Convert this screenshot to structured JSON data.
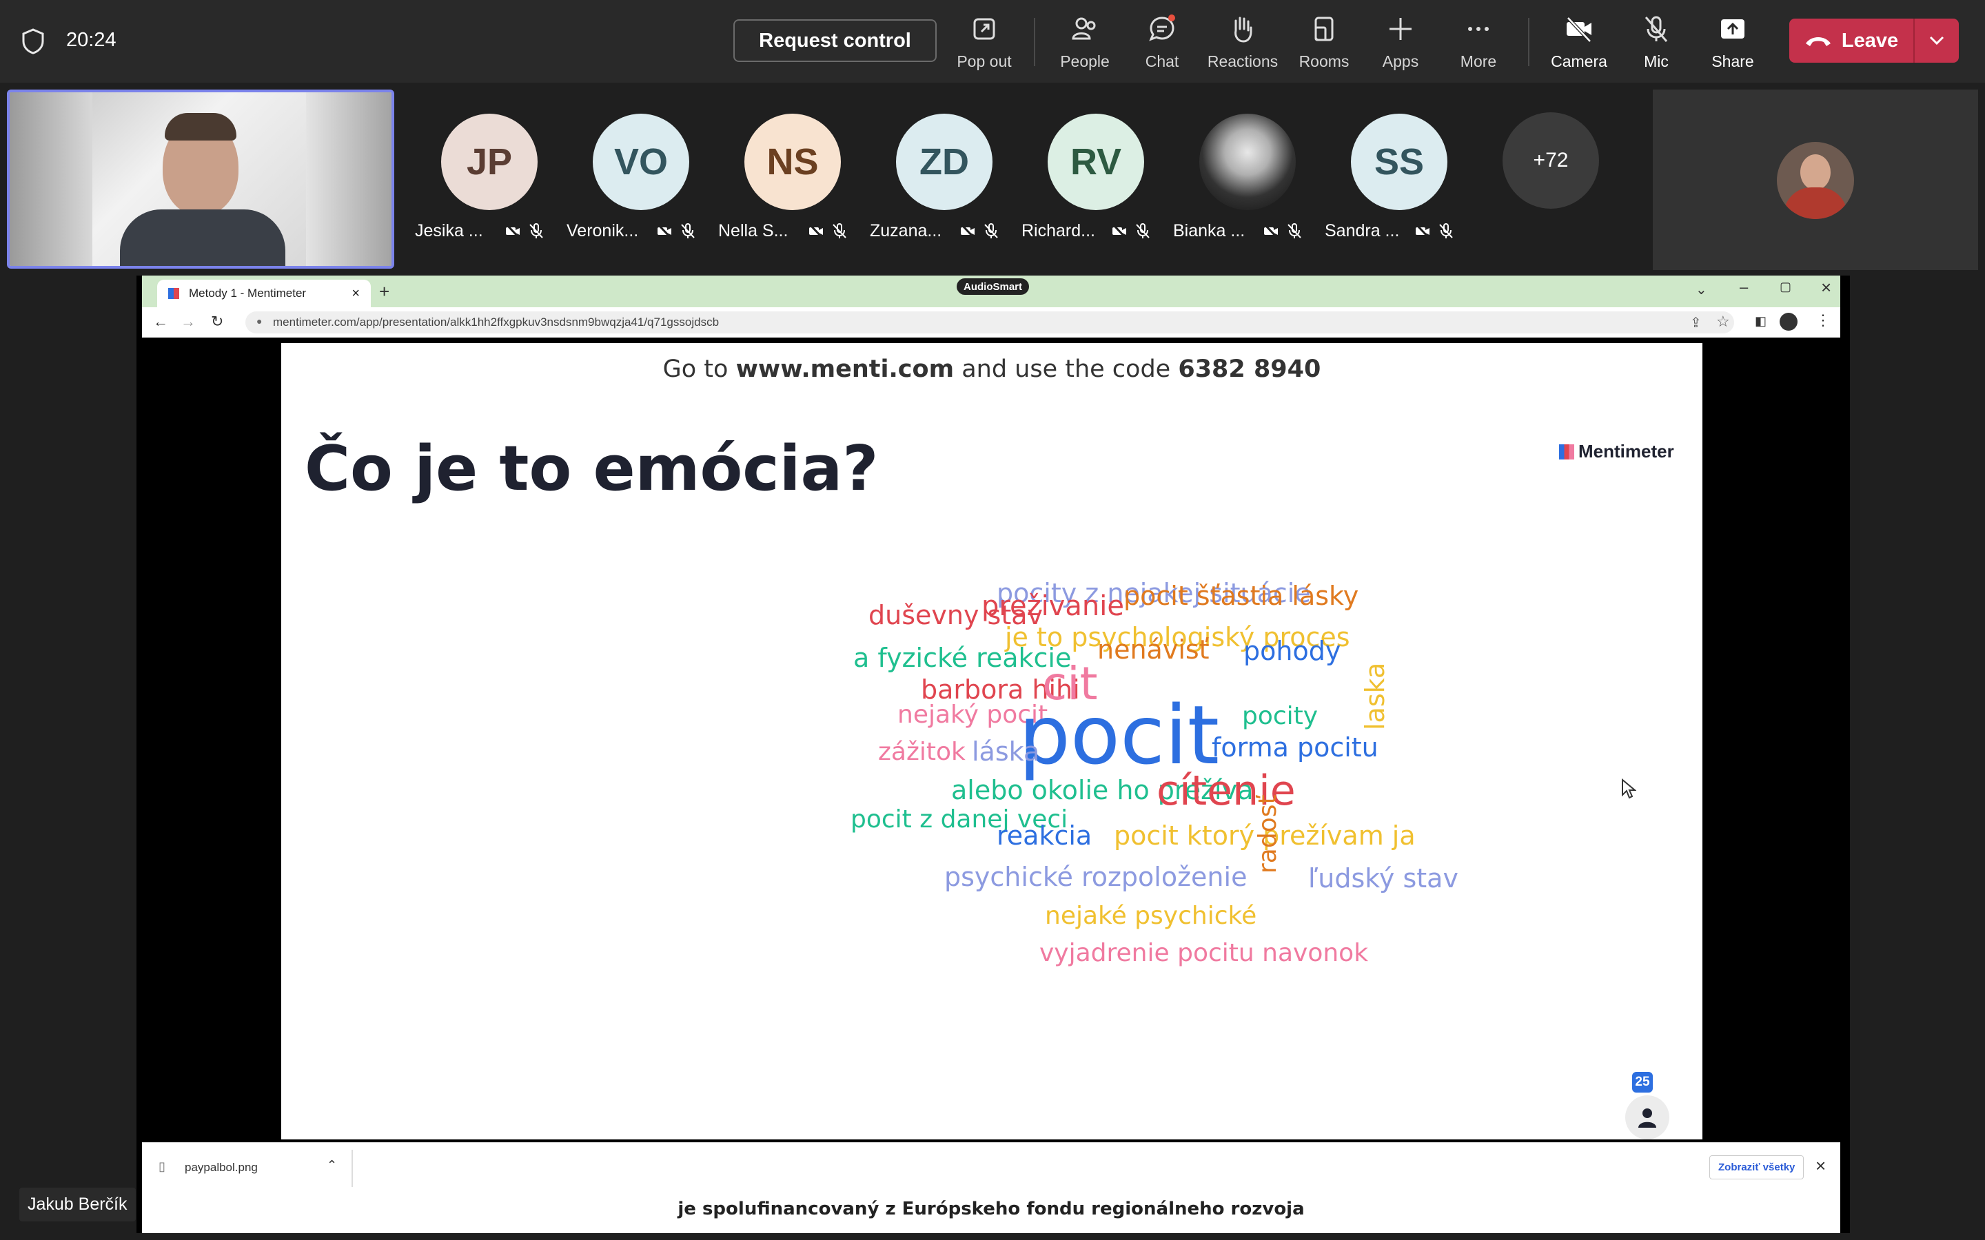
{
  "topbar": {
    "time": "20:24",
    "request_control": "Request control",
    "buttons": {
      "popout": "Pop out",
      "people": "People",
      "chat": "Chat",
      "reactions": "Reactions",
      "rooms": "Rooms",
      "apps": "Apps",
      "more": "More",
      "camera": "Camera",
      "mic": "Mic",
      "share": "Share"
    },
    "leave": "Leave"
  },
  "participants": [
    {
      "initials": "JP",
      "name": "Jesika ...",
      "bg": "#ebdcd6",
      "fg": "#5a3d33"
    },
    {
      "initials": "VO",
      "name": "Veronik...",
      "bg": "#dcecf0",
      "fg": "#33555e"
    },
    {
      "initials": "NS",
      "name": "Nella S...",
      "bg": "#f8e3d0",
      "fg": "#6b4021"
    },
    {
      "initials": "ZD",
      "name": "Zuzana...",
      "bg": "#dcecf0",
      "fg": "#33555e"
    },
    {
      "initials": "RV",
      "name": "Richard...",
      "bg": "#dcefe4",
      "fg": "#2d5a41"
    },
    {
      "initials": "",
      "name": "Bianka ...",
      "bg": "#222222",
      "fg": "#ffffff"
    },
    {
      "initials": "SS",
      "name": "Sandra ...",
      "bg": "#dcecf0",
      "fg": "#33555e"
    }
  ],
  "overflow_count": "+72",
  "presenter_name": "Jakub Berčík",
  "browser": {
    "brand_badge": "AudioSmart",
    "tab_title": "Metody 1 - Mentimeter",
    "url": "mentimeter.com/app/presentation/alkk1hh2ffxgpkuv3nsdsnm9bwqzja41/q71gssojdscb",
    "download_file": "paypalbol.png",
    "show_all": "Zobraziť všetky",
    "bottom_text": "je spolufinancovaný z Európskeho fondu regionálneho rozvoja"
  },
  "slide": {
    "join_prefix": "Go to ",
    "join_site": "www.menti.com",
    "join_mid": " and use the code ",
    "join_code": "6382 8940",
    "question": "Čo je to emócia?",
    "logo": "Mentimeter",
    "responses": "25",
    "words": [
      {
        "text": "pocity z nejakej situácie",
        "color": "#8c9ae0"
      },
      {
        "text": "duševny stav",
        "color": "#e0454f"
      },
      {
        "text": "preživanie",
        "color": "#e0454f"
      },
      {
        "text": "pocit šťastia lásky",
        "color": "#e07a1f"
      },
      {
        "text": "je to psychologiský proces",
        "color": "#f0c030"
      },
      {
        "text": "a fyzické reakcie",
        "color": "#1fbf8f"
      },
      {
        "text": "barbora hihi",
        "color": "#e0454f"
      },
      {
        "text": "cit",
        "color": "#f07aa0"
      },
      {
        "text": "nenávisť",
        "color": "#e07a1f"
      },
      {
        "text": "pohody",
        "color": "#2d6fe0"
      },
      {
        "text": "nejaký pocit",
        "color": "#f07aa0"
      },
      {
        "text": "pocit",
        "color": "#2d6fe0"
      },
      {
        "text": "pocity",
        "color": "#1fbf8f"
      },
      {
        "text": "laska",
        "color": "#f0c030"
      },
      {
        "text": "zážitok",
        "color": "#f07aa0"
      },
      {
        "text": "láska",
        "color": "#8c9ae0"
      },
      {
        "text": "forma pocitu",
        "color": "#2d6fe0"
      },
      {
        "text": "alebo okolie ho prežíva",
        "color": "#1fbf8f"
      },
      {
        "text": "cítenie",
        "color": "#e0454f"
      },
      {
        "text": "pocit z danej veci",
        "color": "#1fbf8f"
      },
      {
        "text": "reakcia",
        "color": "#2d6fe0"
      },
      {
        "text": "pocit ktorý prežívam ja",
        "color": "#f0c030"
      },
      {
        "text": "psychické rozpoloženie",
        "color": "#8c9ae0"
      },
      {
        "text": "radosť",
        "color": "#e07a1f"
      },
      {
        "text": "ľudský stav",
        "color": "#8c9ae0"
      },
      {
        "text": "nejaké psychické",
        "color": "#f0c030"
      },
      {
        "text": "vyjadrenie pocitu navonok",
        "color": "#f07aa0"
      }
    ]
  }
}
